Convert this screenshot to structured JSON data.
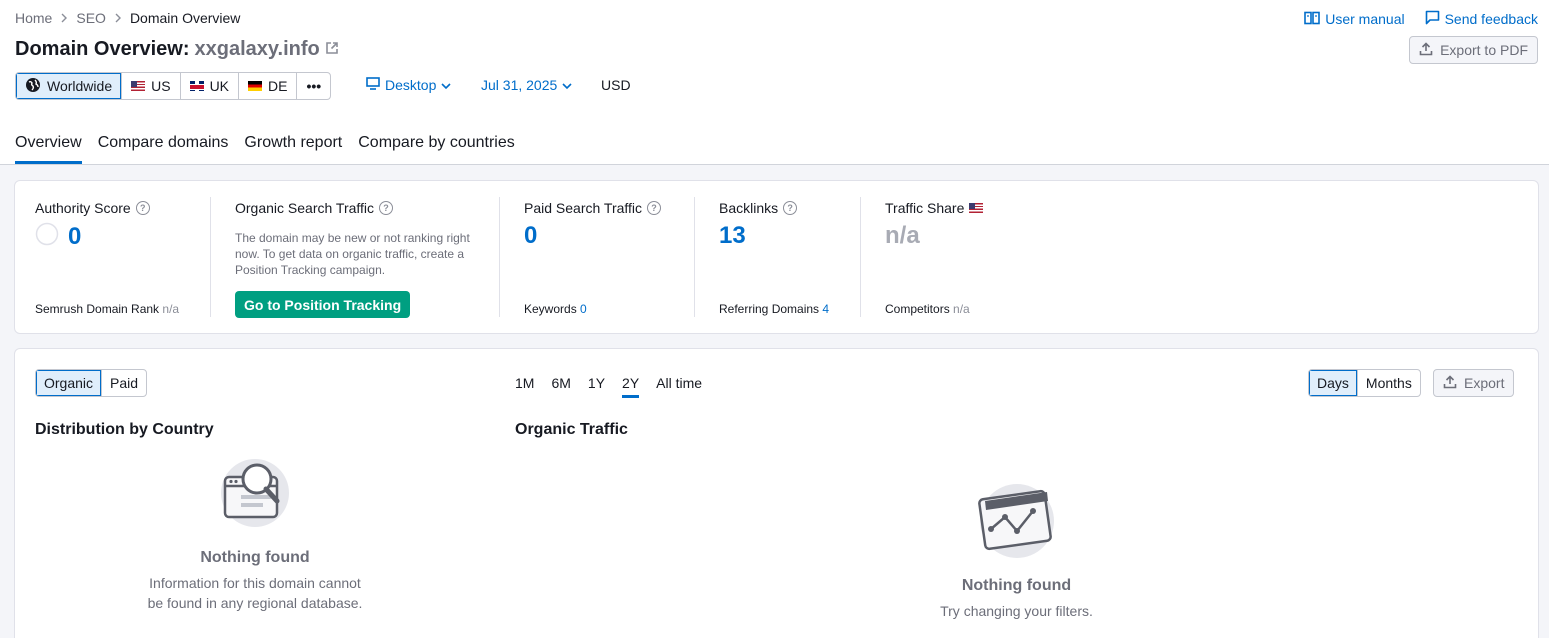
{
  "breadcrumb": {
    "home": "Home",
    "seo": "SEO",
    "current": "Domain Overview"
  },
  "top_links": {
    "manual": "User manual",
    "feedback": "Send feedback"
  },
  "title": {
    "prefix": "Domain Overview:",
    "domain": "xxgalaxy.info"
  },
  "export_pdf": "Export to PDF",
  "databases": {
    "worldwide": "Worldwide",
    "us": "US",
    "uk": "UK",
    "de": "DE",
    "more": "•••"
  },
  "device": "Desktop",
  "date": "Jul 31, 2025",
  "currency": "USD",
  "tabs": [
    "Overview",
    "Compare domains",
    "Growth report",
    "Compare by countries"
  ],
  "metrics": {
    "authority": {
      "label": "Authority Score",
      "value": "0",
      "sub_label": "Semrush Domain Rank",
      "sub_value": "n/a"
    },
    "organic": {
      "label": "Organic Search Traffic",
      "note": "The domain may be new or not ranking right now. To get data on organic traffic, create a Position Tracking campaign.",
      "button": "Go to Position Tracking"
    },
    "paid": {
      "label": "Paid Search Traffic",
      "value": "0",
      "sub_label": "Keywords",
      "sub_value": "0"
    },
    "backlinks": {
      "label": "Backlinks",
      "value": "13",
      "sub_label": "Referring Domains",
      "sub_value": "4"
    },
    "share": {
      "label": "Traffic Share",
      "value": "n/a",
      "sub_label": "Competitors",
      "sub_value": "n/a"
    }
  },
  "lower": {
    "toggle": {
      "organic": "Organic",
      "paid": "Paid"
    },
    "periods": [
      "1M",
      "6M",
      "1Y",
      "2Y",
      "All time"
    ],
    "active_period": "2Y",
    "granularity": {
      "days": "Days",
      "months": "Months"
    },
    "export": "Export",
    "distribution": {
      "title": "Distribution by Country",
      "empty_title": "Nothing found",
      "empty_text_1": "Information for this domain cannot",
      "empty_text_2": "be found in any regional database."
    },
    "traffic": {
      "title": "Organic Traffic",
      "empty_title": "Nothing found",
      "empty_text": "Try changing your filters."
    }
  },
  "colors": {
    "accent": "#006dca",
    "green": "#009f81",
    "text": "#171a22",
    "muted": "#6c6e79"
  }
}
